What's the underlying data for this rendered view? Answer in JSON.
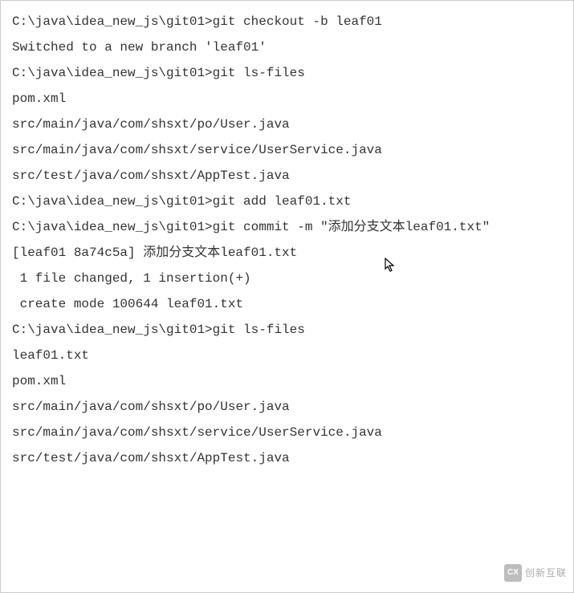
{
  "lines": {
    "l1": "C:\\java\\idea_new_js\\git01>git checkout -b leaf01",
    "l2": "Switched to a new branch 'leaf01'",
    "l3": "",
    "l4": "C:\\java\\idea_new_js\\git01>git ls-files",
    "l5": "pom.xml",
    "l6": "src/main/java/com/shsxt/po/User.java",
    "l7": "src/main/java/com/shsxt/service/UserService.java",
    "l8": "src/test/java/com/shsxt/AppTest.java",
    "l9": "",
    "l10": "C:\\java\\idea_new_js\\git01>git add leaf01.txt",
    "l11": "",
    "l12": "C:\\java\\idea_new_js\\git01>git commit -m \"添加分支文本leaf01.txt\"",
    "l13": "[leaf01 8a74c5a] 添加分支文本leaf01.txt",
    "l14": " 1 file changed, 1 insertion(+)",
    "l15": " create mode 100644 leaf01.txt",
    "l16": "",
    "l17": "C:\\java\\idea_new_js\\git01>git ls-files",
    "l18": "leaf01.txt",
    "l19": "pom.xml",
    "l20": "src/main/java/com/shsxt/po/User.java",
    "l21": "src/main/java/com/shsxt/service/UserService.java",
    "l22": "src/test/java/com/shsxt/AppTest.java"
  },
  "watermark": {
    "logo": "CX",
    "text": "创新互联"
  }
}
